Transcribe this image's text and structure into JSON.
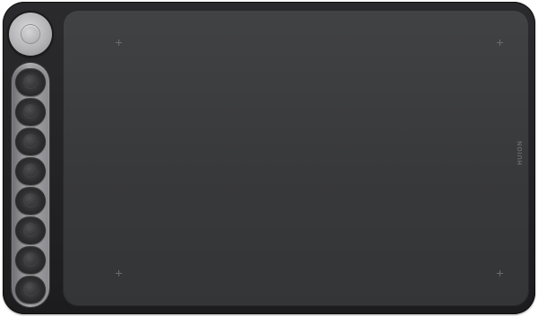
{
  "device": {
    "brand_text": "HUION",
    "colors": {
      "body": "#1c1c1e",
      "active_area": "#3a3b3d",
      "rail": "#9a9a9e",
      "dial": "#b4b4b7"
    },
    "controls": {
      "dial": "dial-icon",
      "express_keys_count": 8
    }
  }
}
